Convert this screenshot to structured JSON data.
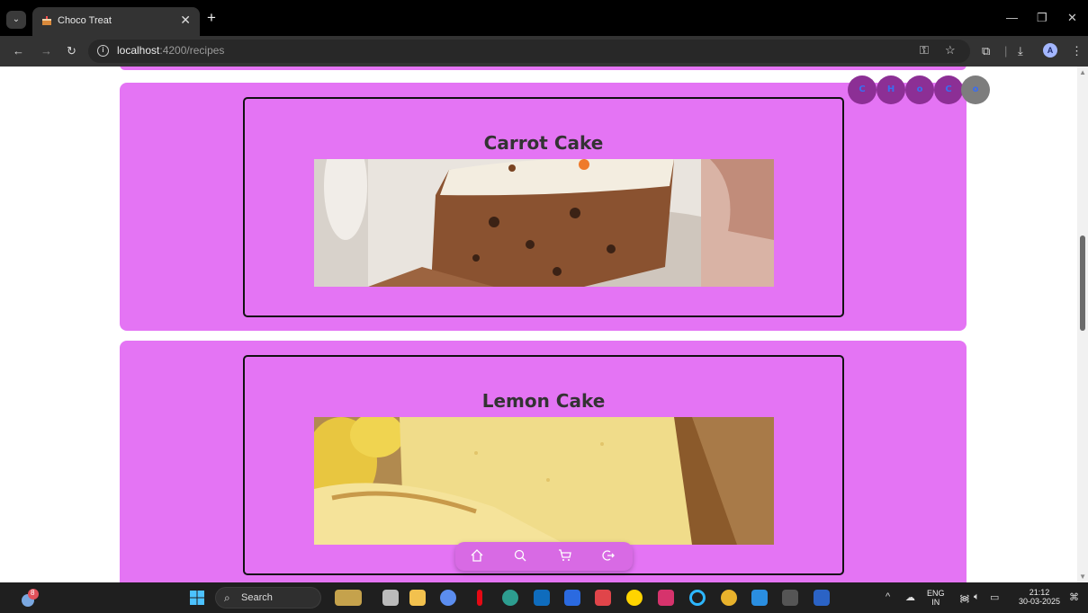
{
  "browser": {
    "tab_title": "Choco Treat",
    "tab_close": "✕",
    "new_tab": "+",
    "url_host": "localhost",
    "url_path": ":4200/recipes",
    "profile_initial": "A"
  },
  "badges": [
    "C",
    "H",
    "o",
    "C",
    "o"
  ],
  "recipes": [
    {
      "title": "Carrot Cake"
    },
    {
      "title": "Lemon Cake"
    }
  ],
  "bottom_nav": {
    "items": [
      "home-icon",
      "search-icon",
      "cart-icon",
      "logout-icon"
    ]
  },
  "taskbar": {
    "search_label": "Search",
    "weather_badge": "8",
    "lang_top": "ENG",
    "lang_bottom": "IN",
    "time": "21:12",
    "date": "30-03-2025"
  },
  "colors": {
    "card_bg": "#e474f4",
    "badge_bg": "#8c2f95",
    "badge_text": "#3b6df0"
  }
}
